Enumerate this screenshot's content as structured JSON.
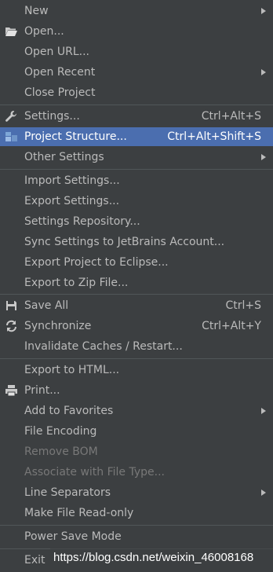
{
  "menu": {
    "new": {
      "label": "New"
    },
    "open": {
      "label": "Open...",
      "icon": "folder-open-icon"
    },
    "open_url": {
      "label": "Open URL..."
    },
    "open_recent": {
      "label": "Open Recent"
    },
    "close_project": {
      "label": "Close Project"
    },
    "settings": {
      "label": "Settings...",
      "shortcut": "Ctrl+Alt+S",
      "icon": "wrench-icon"
    },
    "project_structure": {
      "label": "Project Structure...",
      "shortcut": "Ctrl+Alt+Shift+S",
      "icon": "project-structure-icon"
    },
    "other_settings": {
      "label": "Other Settings"
    },
    "import_settings": {
      "label": "Import Settings..."
    },
    "export_settings": {
      "label": "Export Settings..."
    },
    "settings_repository": {
      "label": "Settings Repository..."
    },
    "sync_settings": {
      "label": "Sync Settings to JetBrains Account..."
    },
    "export_eclipse": {
      "label": "Export Project to Eclipse..."
    },
    "export_zip": {
      "label": "Export to Zip File..."
    },
    "save_all": {
      "label": "Save All",
      "shortcut": "Ctrl+S",
      "icon": "save-icon"
    },
    "synchronize": {
      "label": "Synchronize",
      "shortcut": "Ctrl+Alt+Y",
      "icon": "sync-icon"
    },
    "invalidate_caches": {
      "label": "Invalidate Caches / Restart..."
    },
    "export_html": {
      "label": "Export to HTML..."
    },
    "print": {
      "label": "Print...",
      "icon": "printer-icon"
    },
    "add_favorites": {
      "label": "Add to Favorites"
    },
    "file_encoding": {
      "label": "File Encoding"
    },
    "remove_bom": {
      "label": "Remove BOM"
    },
    "associate_file_type": {
      "label": "Associate with File Type..."
    },
    "line_separators": {
      "label": "Line Separators"
    },
    "make_read_only": {
      "label": "Make File Read-only"
    },
    "power_save": {
      "label": "Power Save Mode"
    },
    "exit": {
      "label": "Exit"
    }
  },
  "watermark": "https://blog.csdn.net/weixin_46008168",
  "colors": {
    "background": "#3c3f41",
    "highlight": "#4b6eaf",
    "text": "#bbbbbb",
    "disabled": "#787878"
  }
}
